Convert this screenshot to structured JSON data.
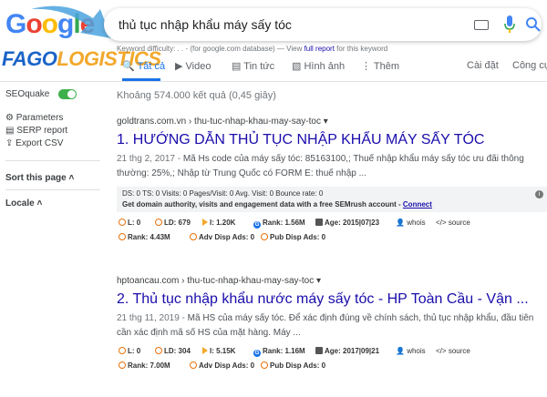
{
  "google_logo": "Google",
  "brand": {
    "part1": "FAGO",
    "part2": "LOGISTICS"
  },
  "search": {
    "query": "thủ tục nhập khẩu máy sấy tóc"
  },
  "keyword_bar": {
    "prefix": "Keyword difficulty: . . - (for google.com database) — View ",
    "link": "full report",
    "suffix": " for this keyword"
  },
  "tabs": {
    "all": "Tất cả",
    "video": "Video",
    "news": "Tin tức",
    "images": "Hình ảnh",
    "more": "Thêm",
    "settings": "Cài đặt",
    "tools": "Công cụ"
  },
  "sidebar": {
    "seoquake": "SEOquake",
    "items": [
      "Parameters",
      "SERP report",
      "Export CSV"
    ],
    "sort": "Sort this page",
    "locale": "Locale"
  },
  "stats": "Khoảng 574.000 kết quả (0,45 giây)",
  "results": [
    {
      "cite": "goldtrans.com.vn › thu-tuc-nhap-khau-may-say-toc ▾",
      "title": "1. HƯỚNG DẪN THỦ TỤC NHẬP KHẨU MÁY SẤY TÓC",
      "date": "21 thg 2, 2017 - ",
      "snippet": "Mã Hs code của máy sấy tóc: 85163100,; Thuế nhập khẩu máy sấy tóc ưu đãi thông thường: 25%,; Nhập từ Trung Quốc có FORM E: thuế nhập ...",
      "bar1": "DS: 0      TS: 0          Visits: 0   Pages/Visit: 0   Avg. Visit: 0   Bounce rate: 0",
      "bar2": "Get domain authority, visits and engagement data with a free SEMrush account - ",
      "bar2_link": "Connect",
      "m": [
        "L: 0",
        "LD: 679",
        "I: 1.20K",
        "Rank: 1.56M",
        "Age: 2015|07|23",
        "whois",
        "source"
      ],
      "m2": [
        "Rank: 4.43M",
        "Adv Disp Ads: 0",
        "Pub Disp Ads: 0"
      ]
    },
    {
      "cite": "hptoancau.com › thu-tuc-nhap-khau-may-say-toc ▾",
      "title": "2. Thủ tục nhập khẩu nước máy sấy tóc - HP Toàn Cầu - Vận ...",
      "date": "21 thg 11, 2019 - ",
      "snippet": "Mã HS của máy sấy tóc. Để xác định đúng về chính sách, thủ tục nhập khẩu, đầu tiên cần xác định mã số HS của mặt hàng. Máy ...",
      "m": [
        "L: 0",
        "LD: 304",
        "I: 5.15K",
        "Rank: 1.16M",
        "Age: 2017|09|21",
        "whois",
        "source"
      ],
      "m2": [
        "Rank: 7.00M",
        "Adv Disp Ads: 0",
        "Pub Disp Ads: 0"
      ]
    }
  ],
  "colors": {
    "link": "#1a0dab",
    "accent": "#1a73e8",
    "brand_blue": "#1a64c8",
    "brand_orange": "#f2a82c"
  }
}
